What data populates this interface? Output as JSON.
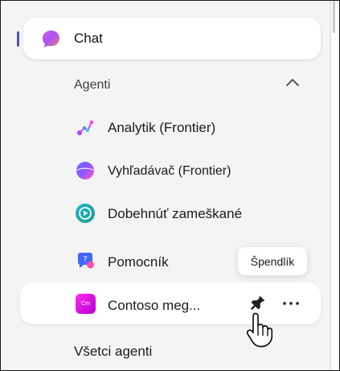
{
  "nav": {
    "chat_label": "Chat"
  },
  "agents_section": {
    "label": "Agenti",
    "items": [
      {
        "label": "Analytik (Frontier)",
        "icon": "analytics-icon"
      },
      {
        "label": "Vyhľadávač (Frontier)",
        "icon": "search-agent-icon"
      },
      {
        "label": "Dobehnúť zameškané",
        "icon": "catch-up-icon"
      },
      {
        "label": "Pomocník",
        "icon": "help-icon"
      },
      {
        "label": "Contoso meg...",
        "icon": "contoso-agent-icon",
        "icon_text": "Cm"
      }
    ],
    "all_agents_label": "Všetci agenti"
  },
  "tooltip": {
    "label": "Špendlík"
  },
  "colors": {
    "active_indicator": "#4f52b2",
    "contoso_gradient_start": "#ff2be6",
    "contoso_gradient_end": "#b300d9"
  }
}
